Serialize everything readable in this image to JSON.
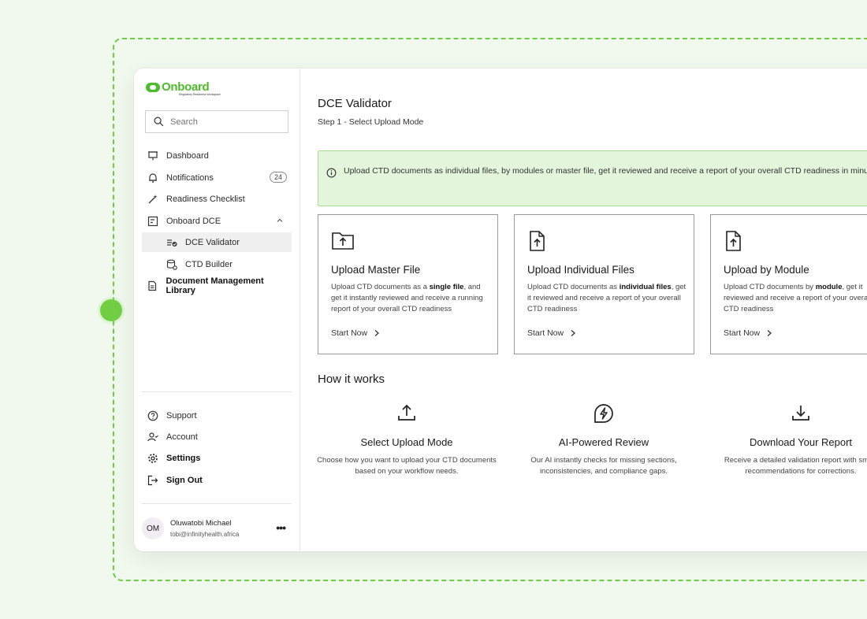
{
  "brand": {
    "name": "Onboard",
    "tagline": "Regulatory Readiness Workspace",
    "accent": "#4cbc2a"
  },
  "search": {
    "placeholder": "Search"
  },
  "nav": {
    "dashboard": "Dashboard",
    "notifications": "Notifications",
    "notifications_count": "24",
    "checklist": "Readiness Checklist",
    "onboard_dce": "Onboard DCE",
    "dce_validator": "DCE Validator",
    "ctd_builder": "CTD Builder",
    "library": "Document Management Library"
  },
  "footer_nav": {
    "support": "Support",
    "account": "Account",
    "settings": "Settings",
    "sign_out": "Sign Out"
  },
  "user": {
    "initials": "OM",
    "name": "Oluwatobi Michael",
    "email": "tobi@infinityhealth.africa"
  },
  "page": {
    "title": "DCE Validator",
    "step": "Step 1 - Select Upload Mode",
    "info": "Upload CTD documents as individual files, by modules or master file, get it reviewed and receive a report of your overall CTD readiness in minutes"
  },
  "cards": [
    {
      "title": "Upload Master File",
      "desc_pre": "Upload CTD documents as a ",
      "desc_bold": "single file",
      "desc_post": ", and get it instantly reviewed and receive a running report of your overall CTD readiness",
      "cta": "Start Now"
    },
    {
      "title": "Upload Individual Files",
      "desc_pre": "Upload CTD documents as ",
      "desc_bold": "individual files",
      "desc_post": ", get it reviewed and receive a report of your overall CTD readiness",
      "cta": "Start Now"
    },
    {
      "title": "Upload by Module",
      "desc_pre": "Upload CTD documents by ",
      "desc_bold": "module",
      "desc_post": ", get it reviewed and receive a report of your overall CTD readiness",
      "cta": "Start Now"
    }
  ],
  "how": {
    "title": "How it works",
    "steps": [
      {
        "title": "Select Upload Mode",
        "desc": "Choose how you want to upload your CTD documents based on your workflow needs."
      },
      {
        "title": "AI-Powered Review",
        "desc": "Our AI instantly checks for missing sections, inconsistencies, and compliance gaps."
      },
      {
        "title": "Download Your Report",
        "desc": "Receive a detailed validation report with smart recommendations for corrections."
      }
    ]
  }
}
